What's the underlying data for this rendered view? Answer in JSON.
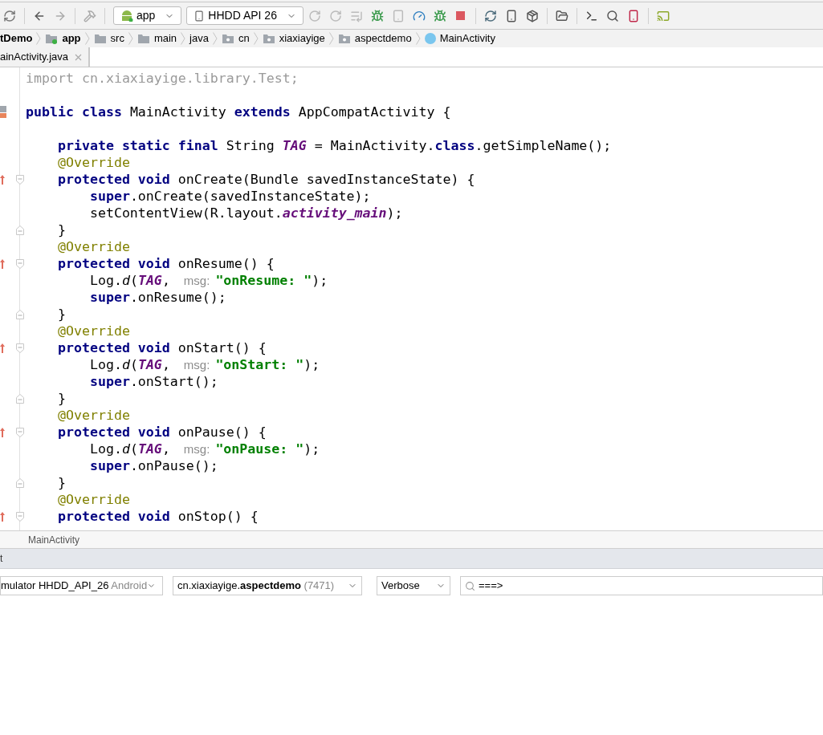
{
  "toolbar": {
    "run_config": "app",
    "device": "HHDD API 26"
  },
  "breadcrumb": [
    {
      "label": "tDemo",
      "kind": "project"
    },
    {
      "label": "app",
      "kind": "module"
    },
    {
      "label": "src",
      "kind": "folder"
    },
    {
      "label": "main",
      "kind": "folder"
    },
    {
      "label": "java",
      "kind": "source"
    },
    {
      "label": "cn",
      "kind": "package"
    },
    {
      "label": "xiaxiayige",
      "kind": "package"
    },
    {
      "label": "aspectdemo",
      "kind": "package"
    },
    {
      "label": "MainActivity",
      "kind": "class"
    }
  ],
  "tabs": [
    {
      "label": "ainActivity.java",
      "selected": true
    }
  ],
  "code_lines": [
    {
      "kind": "code",
      "segments": [
        {
          "kind": "import",
          "text": "import cn.xiaxiayige.library.Test;"
        }
      ]
    },
    {
      "kind": "blank"
    },
    {
      "kind": "class",
      "segments": [
        {
          "kind": "kw",
          "text": "public class "
        },
        {
          "kind": "plain",
          "text": "MainActivity "
        },
        {
          "kind": "kw",
          "text": "extends "
        },
        {
          "kind": "plain",
          "text": "AppCompatActivity {"
        }
      ]
    },
    {
      "kind": "blank"
    },
    {
      "kind": "code",
      "segments": [
        {
          "kind": "kw",
          "text": "    private static final "
        },
        {
          "kind": "plain",
          "text": "String "
        },
        {
          "kind": "field",
          "text": "TAG"
        },
        {
          "kind": "plain",
          "text": " = MainActivity."
        },
        {
          "kind": "kw",
          "text": "class"
        },
        {
          "kind": "plain",
          "text": ".getSimpleName();"
        }
      ]
    },
    {
      "kind": "code",
      "segments": [
        {
          "kind": "ann",
          "text": "    @Override"
        }
      ]
    },
    {
      "kind": "method",
      "segments": [
        {
          "kind": "kw",
          "text": "    protected void "
        },
        {
          "kind": "plain",
          "text": "onCreate(Bundle savedInstanceState) {"
        }
      ]
    },
    {
      "kind": "code",
      "segments": [
        {
          "kind": "kw",
          "text": "        super"
        },
        {
          "kind": "plain",
          "text": ".onCreate(savedInstanceState);"
        }
      ]
    },
    {
      "kind": "code",
      "segments": [
        {
          "kind": "plain",
          "text": "        setContentView(R.layout."
        },
        {
          "kind": "field",
          "text": "activity_main"
        },
        {
          "kind": "plain",
          "text": ");"
        }
      ]
    },
    {
      "kind": "end",
      "segments": [
        {
          "kind": "plain",
          "text": "    }"
        }
      ]
    },
    {
      "kind": "code",
      "segments": [
        {
          "kind": "ann",
          "text": "    @Override"
        }
      ]
    },
    {
      "kind": "method",
      "segments": [
        {
          "kind": "kw",
          "text": "    protected void "
        },
        {
          "kind": "plain",
          "text": "onResume() {"
        }
      ]
    },
    {
      "kind": "code",
      "segments": [
        {
          "kind": "plain",
          "text": "        Log."
        },
        {
          "kind": "italic",
          "text": "d"
        },
        {
          "kind": "plain",
          "text": "("
        },
        {
          "kind": "field",
          "text": "TAG"
        },
        {
          "kind": "plain",
          "text": ", "
        },
        {
          "kind": "hint",
          "text": "msg:"
        },
        {
          "kind": "str",
          "text": "\"onResume: \""
        },
        {
          "kind": "plain",
          "text": ");"
        }
      ]
    },
    {
      "kind": "code",
      "segments": [
        {
          "kind": "kw",
          "text": "        super"
        },
        {
          "kind": "plain",
          "text": ".onResume();"
        }
      ]
    },
    {
      "kind": "end",
      "segments": [
        {
          "kind": "plain",
          "text": "    }"
        }
      ]
    },
    {
      "kind": "code",
      "segments": [
        {
          "kind": "ann",
          "text": "    @Override"
        }
      ]
    },
    {
      "kind": "method",
      "segments": [
        {
          "kind": "kw",
          "text": "    protected void "
        },
        {
          "kind": "plain",
          "text": "onStart() {"
        }
      ]
    },
    {
      "kind": "code",
      "segments": [
        {
          "kind": "plain",
          "text": "        Log."
        },
        {
          "kind": "italic",
          "text": "d"
        },
        {
          "kind": "plain",
          "text": "("
        },
        {
          "kind": "field",
          "text": "TAG"
        },
        {
          "kind": "plain",
          "text": ", "
        },
        {
          "kind": "hint",
          "text": "msg:"
        },
        {
          "kind": "str",
          "text": "\"onStart: \""
        },
        {
          "kind": "plain",
          "text": ");"
        }
      ]
    },
    {
      "kind": "code",
      "segments": [
        {
          "kind": "kw",
          "text": "        super"
        },
        {
          "kind": "plain",
          "text": ".onStart();"
        }
      ]
    },
    {
      "kind": "end",
      "segments": [
        {
          "kind": "plain",
          "text": "    }"
        }
      ]
    },
    {
      "kind": "code",
      "segments": [
        {
          "kind": "ann",
          "text": "    @Override"
        }
      ]
    },
    {
      "kind": "method",
      "segments": [
        {
          "kind": "kw",
          "text": "    protected void "
        },
        {
          "kind": "plain",
          "text": "onPause() {"
        }
      ]
    },
    {
      "kind": "code",
      "segments": [
        {
          "kind": "plain",
          "text": "        Log."
        },
        {
          "kind": "italic",
          "text": "d"
        },
        {
          "kind": "plain",
          "text": "("
        },
        {
          "kind": "field",
          "text": "TAG"
        },
        {
          "kind": "plain",
          "text": ", "
        },
        {
          "kind": "hint",
          "text": "msg:"
        },
        {
          "kind": "str",
          "text": "\"onPause: \""
        },
        {
          "kind": "plain",
          "text": ");"
        }
      ]
    },
    {
      "kind": "code",
      "segments": [
        {
          "kind": "kw",
          "text": "        super"
        },
        {
          "kind": "plain",
          "text": ".onPause();"
        }
      ]
    },
    {
      "kind": "end",
      "segments": [
        {
          "kind": "plain",
          "text": "    }"
        }
      ]
    },
    {
      "kind": "code",
      "segments": [
        {
          "kind": "ann",
          "text": "    @Override"
        }
      ]
    },
    {
      "kind": "method",
      "segments": [
        {
          "kind": "kw",
          "text": "    protected void "
        },
        {
          "kind": "plain",
          "text": "onStop() {"
        }
      ]
    }
  ],
  "editor_breadcrumb": "MainActivity",
  "panel": {
    "title": "t",
    "device": "mulator HHDD_API_26",
    "device_suffix": "Android",
    "process": "cn.xiaxiayige.**aspectdemo**",
    "process_pid": "(7471)",
    "level": "Verbose",
    "filter": "===>"
  }
}
